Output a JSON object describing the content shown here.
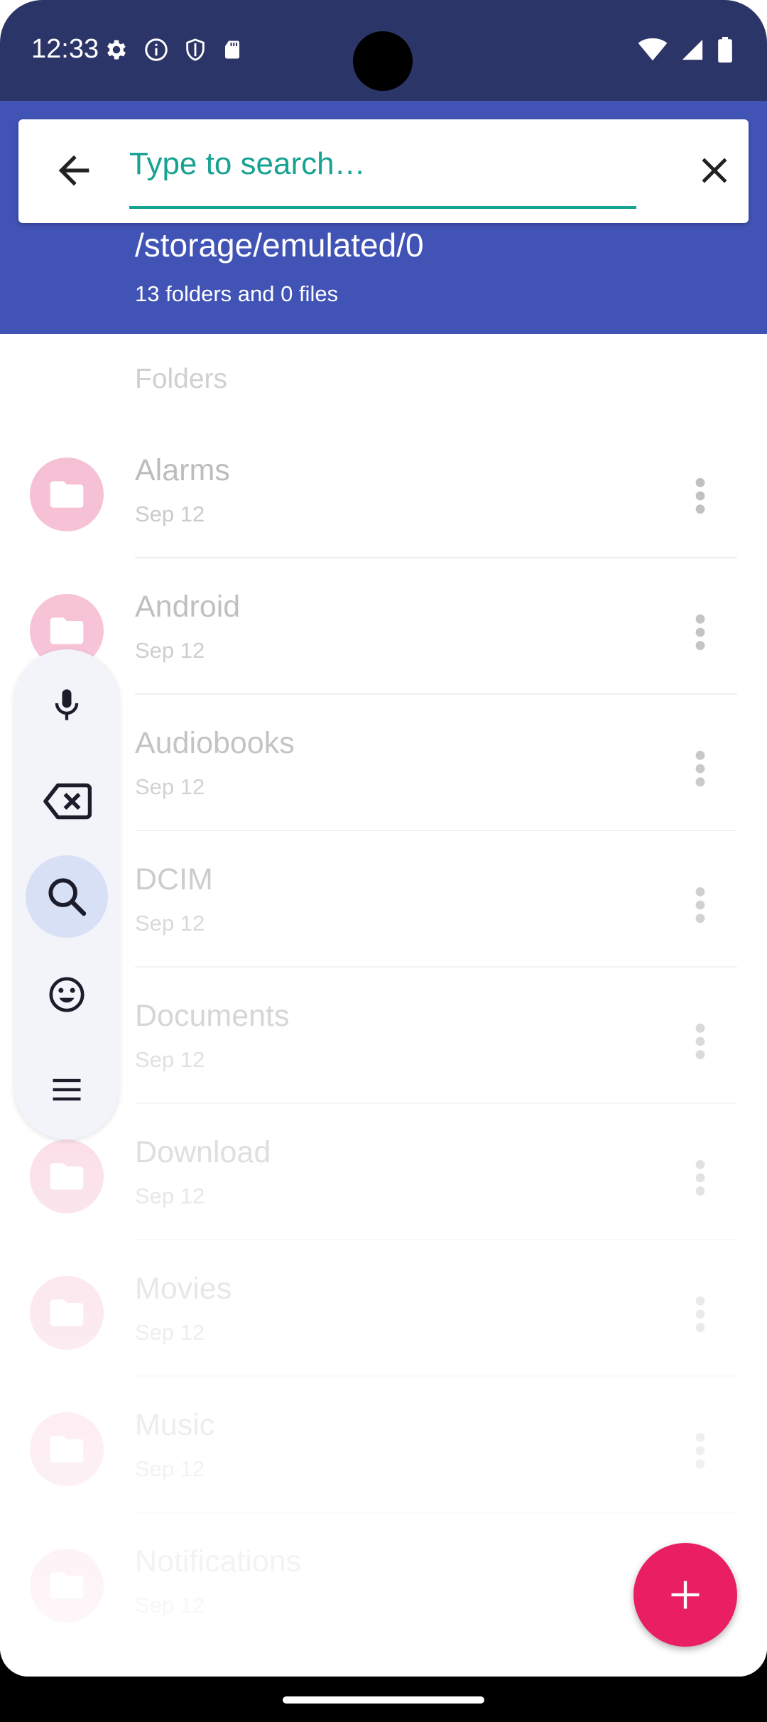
{
  "status_bar": {
    "time": "12:33",
    "left_icons": [
      "gear-icon",
      "info-icon",
      "shield-icon",
      "sd-card-icon"
    ],
    "right_icons": [
      "wifi-icon",
      "signal-icon",
      "battery-icon"
    ]
  },
  "search": {
    "placeholder": "Type to search…",
    "value": ""
  },
  "header": {
    "path": "/storage/emulated/0",
    "counts": "13 folders and 0 files"
  },
  "list": {
    "section_title": "Folders",
    "items": [
      {
        "name": "Alarms",
        "date": "Sep 12"
      },
      {
        "name": "Android",
        "date": "Sep 12"
      },
      {
        "name": "Audiobooks",
        "date": "Sep 12"
      },
      {
        "name": "DCIM",
        "date": "Sep 12"
      },
      {
        "name": "Documents",
        "date": "Sep 12"
      },
      {
        "name": "Download",
        "date": "Sep 12"
      },
      {
        "name": "Movies",
        "date": "Sep 12"
      },
      {
        "name": "Music",
        "date": "Sep 12"
      },
      {
        "name": "Notifications",
        "date": "Sep 12"
      }
    ]
  },
  "side_toolbar": {
    "tools": [
      "microphone-icon",
      "backspace-icon",
      "search-icon",
      "emoji-icon",
      "menu-icon"
    ],
    "active": "search-icon"
  },
  "fab": {
    "icon": "plus-icon"
  },
  "colors": {
    "status_bar": "#2c3568",
    "header": "#4153b5",
    "accent": "#17a291",
    "fab": "#e91e63",
    "folder_circle": "#f6bdd2"
  }
}
